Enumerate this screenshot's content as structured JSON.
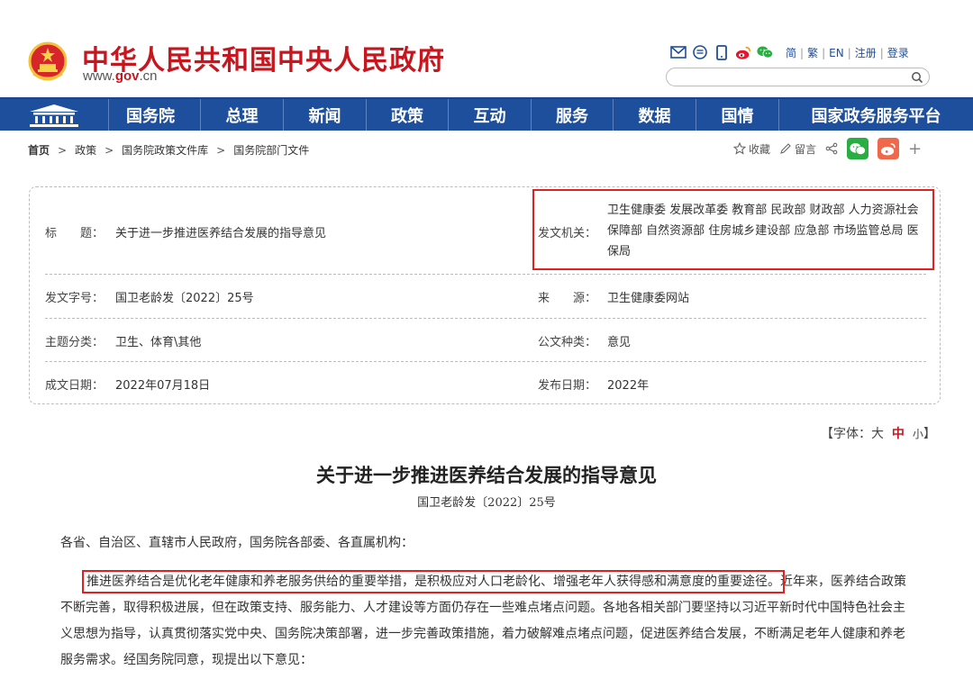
{
  "header": {
    "site_title": "中华人民共和国中央人民政府",
    "url_prefix": "www.",
    "url_domain": "gov",
    "url_suffix": ".cn",
    "tool_icons": [
      "mail-icon",
      "rss-icon",
      "mobile-icon",
      "weibo-icon",
      "wechat-icon"
    ],
    "lang_links": [
      "简",
      "繁",
      "EN",
      "注册",
      "登录"
    ],
    "search_placeholder": ""
  },
  "nav": {
    "items": [
      "国务院",
      "总理",
      "新闻",
      "政策",
      "互动",
      "服务",
      "数据",
      "国情",
      "国家政务服务平台"
    ]
  },
  "breadcrumb": {
    "items": [
      "首页",
      "政策",
      "国务院政策文件库",
      "国务院部门文件"
    ],
    "collect_label": "收藏",
    "comment_label": "留言"
  },
  "info": {
    "title_label": "标　　题：",
    "title_value": "关于进一步推进医养结合发展的指导意见",
    "issuer_label": "发文机关：",
    "issuer_value": "卫生健康委 发展改革委 教育部 民政部 财政部 人力资源社会保障部 自然资源部 住房城乡建设部 应急部 市场监管总局 医保局",
    "docno_label": "发文字号：",
    "docno_value": "国卫老龄发〔2022〕25号",
    "source_label": "来　　源：",
    "source_value": "卫生健康委网站",
    "topic_label": "主题分类：",
    "topic_value": "卫生、体育\\其他",
    "type_label": "公文种类：",
    "type_value": "意见",
    "written_label": "成文日期：",
    "written_value": "2022年07月18日",
    "publish_label": "发布日期：",
    "publish_value": "2022年"
  },
  "font_size": {
    "prefix": "【字体：",
    "large": "大",
    "medium": "中",
    "small": "小",
    "suffix": "】"
  },
  "article": {
    "title": "关于进一步推进医养结合发展的指导意见",
    "doc_no": "国卫老龄发〔2022〕25号",
    "salutation": "各省、自治区、直辖市人民政府，国务院各部委、各直属机构：",
    "para_highlight": "推进医养结合是优化老年健康和养老服务供给的重要举措，是积极应对人口老龄化、增强老年人获得感和满意度的重要途径。",
    "para_rest": "近年来，医养结合政策不断完善，取得积极进展，但在政策支持、服务能力、人才建设等方面仍存在一些难点堵点问题。各地各相关部门要坚持以习近平新时代中国特色社会主义思想为指导，认真贯彻落实党中央、国务院决策部署，进一步完善政策措施，着力破解难点堵点问题，促进医养结合发展，不断满足老年人健康和养老服务需求。经国务院同意，现提出以下意见："
  },
  "colors": {
    "brand_red": "#c8161e",
    "nav_blue": "#1e4f9c",
    "highlight_red": "#e22020",
    "wechat_green": "#2aae43",
    "weibo_orange": "#f0684a"
  }
}
